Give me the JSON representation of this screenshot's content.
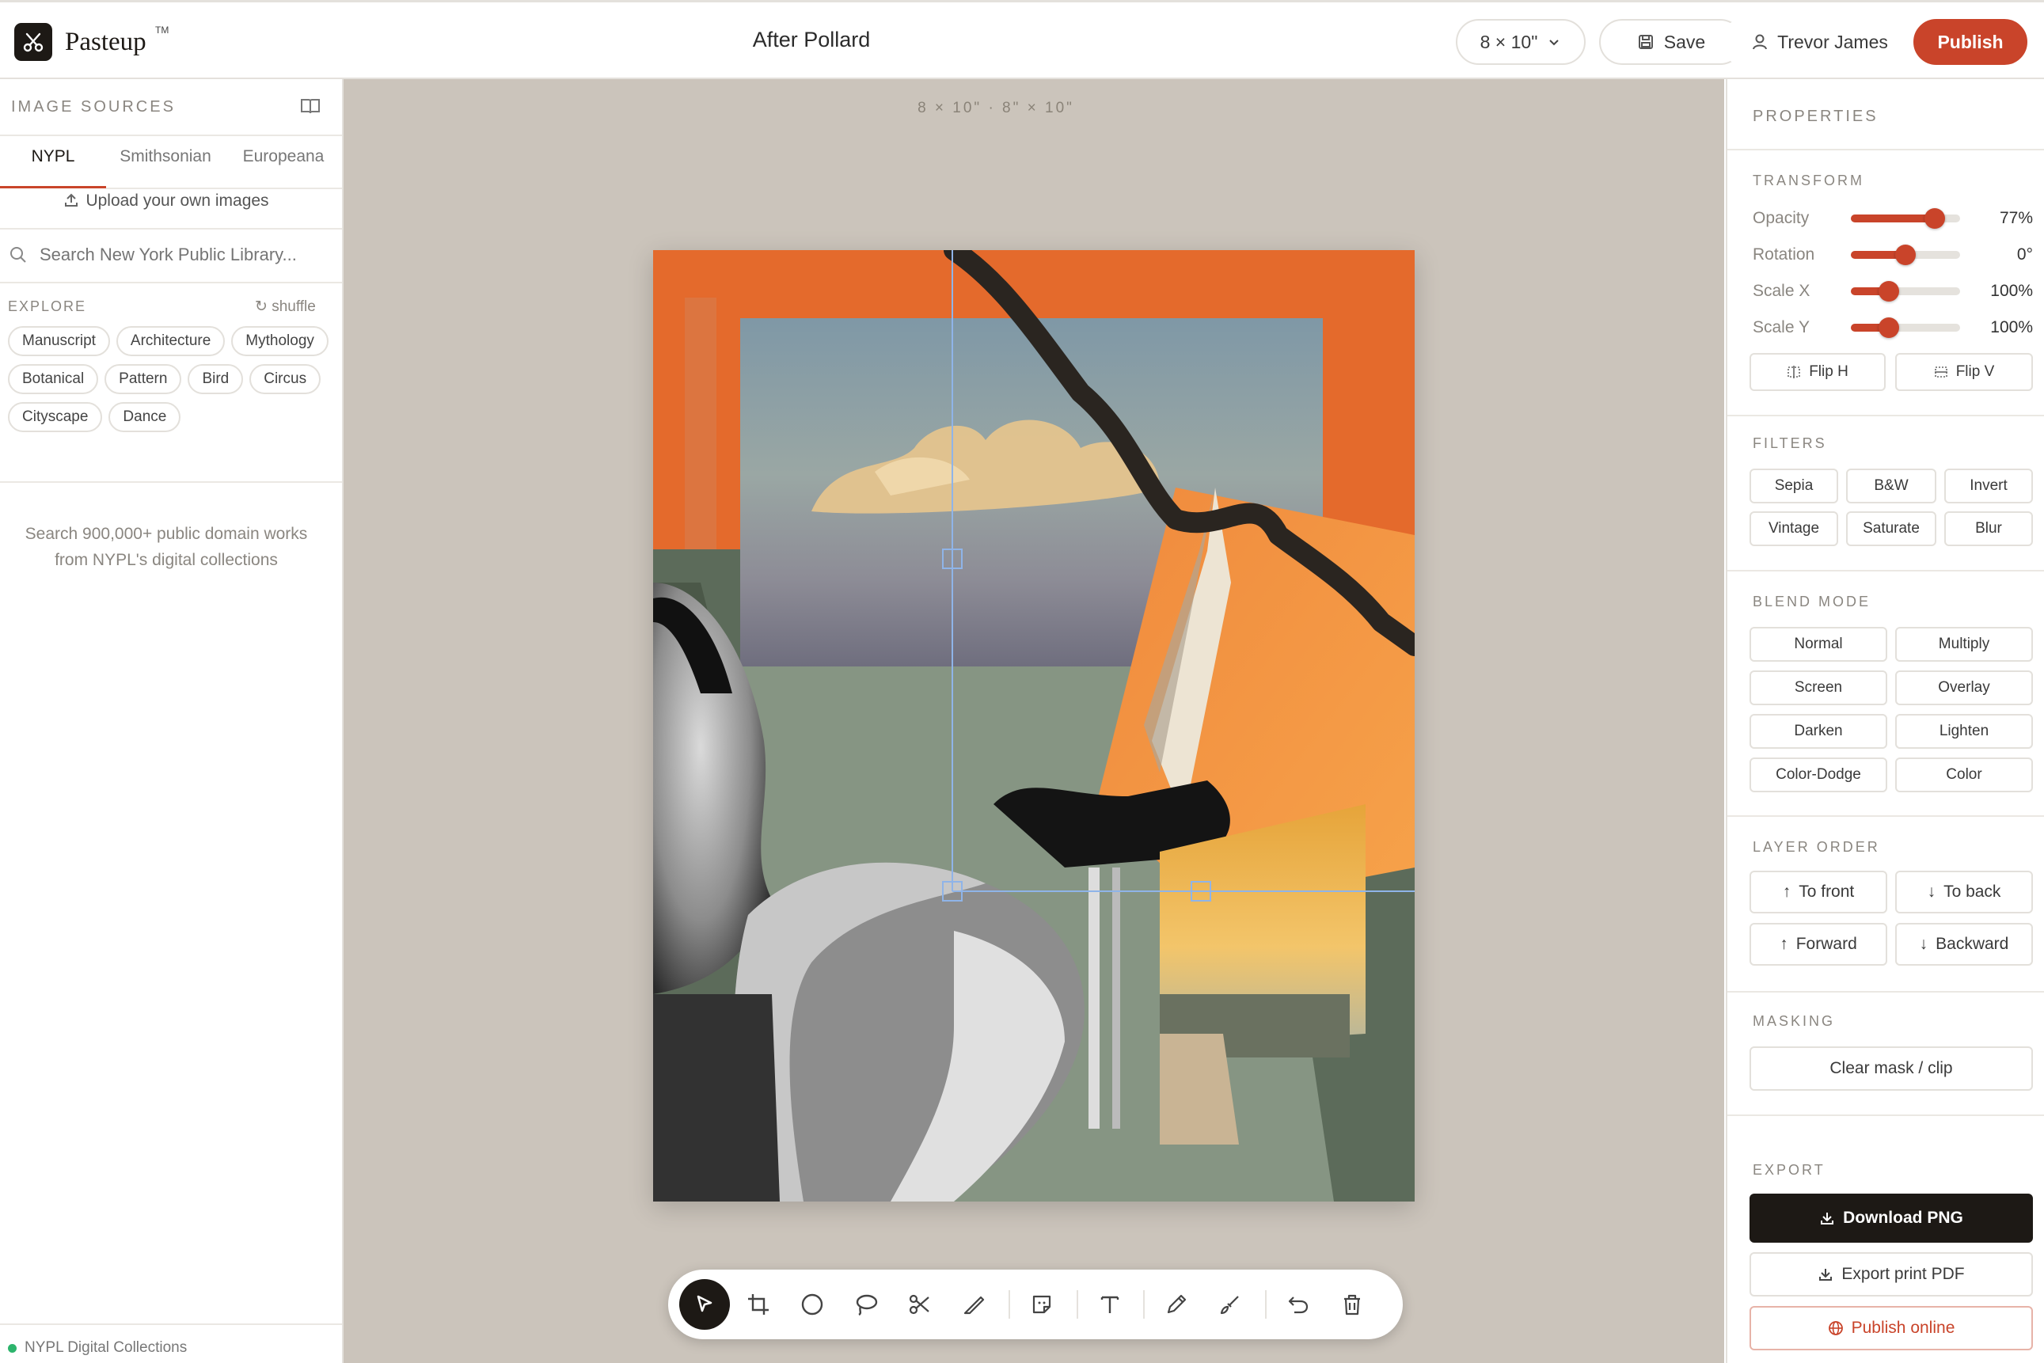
{
  "app": {
    "name": "Pasteup",
    "trademark": "TM"
  },
  "header": {
    "doc_title": "After Pollard",
    "size_select": "8 × 10\"",
    "save_label": "Save",
    "user_name": "Trevor James",
    "publish_label": "Publish"
  },
  "left": {
    "heading": "IMAGE SOURCES",
    "tabs": [
      {
        "label": "NYPL",
        "active": true
      },
      {
        "label": "Smithsonian"
      },
      {
        "label": "Europeana"
      }
    ],
    "upload_label": "Upload your own images",
    "search_placeholder": "Search New York Public Library...",
    "explore_label": "EXPLORE",
    "shuffle_label": "shuffle",
    "chips": [
      "Manuscript",
      "Architecture",
      "Mythology",
      "Botanical",
      "Pattern",
      "Bird",
      "Circus",
      "Cityscape",
      "Dance"
    ],
    "hint_line1": "Search 900,000+ public domain works",
    "hint_line2": "from NYPL's digital collections",
    "footer": "NYPL Digital Collections"
  },
  "canvas": {
    "label": "8 × 10\" · 8\" × 10\"",
    "tools": [
      "select-icon",
      "crop-icon",
      "ellipse-icon",
      "lasso-icon",
      "scissors-icon",
      "knife-icon",
      "sticker-icon",
      "text-icon",
      "pencil-icon",
      "brush-icon",
      "undo-icon",
      "trash-icon"
    ]
  },
  "properties": {
    "heading": "PROPERTIES",
    "transform": {
      "label": "TRANSFORM",
      "opacity": {
        "label": "Opacity",
        "value": "77%",
        "fraction": 0.77
      },
      "rotation": {
        "label": "Rotation",
        "value": "0°",
        "fraction": 0.5
      },
      "scale_x": {
        "label": "Scale X",
        "value": "100%",
        "fraction": 0.35
      },
      "scale_y": {
        "label": "Scale Y",
        "value": "100%",
        "fraction": 0.35
      },
      "flip_h": "Flip H",
      "flip_v": "Flip V"
    },
    "filters": {
      "label": "FILTERS",
      "items": [
        "Sepia",
        "B&W",
        "Invert",
        "Vintage",
        "Saturate",
        "Blur"
      ]
    },
    "blend": {
      "label": "BLEND MODE",
      "items": [
        "Normal",
        "Multiply",
        "Screen",
        "Overlay",
        "Darken",
        "Lighten",
        "Color-Dodge",
        "Color"
      ]
    },
    "layer_order": {
      "label": "LAYER ORDER",
      "to_front": "To front",
      "to_back": "To back",
      "forward": "Forward",
      "backward": "Backward"
    },
    "masking": {
      "label": "MASKING",
      "clear": "Clear mask / clip"
    },
    "export": {
      "label": "EXPORT",
      "download_png": "Download PNG",
      "export_pdf": "Export print PDF",
      "publish_online": "Publish online"
    }
  },
  "colors": {
    "accent": "#c9442a",
    "dark": "#1d1915",
    "canvas_bg": "#cbc4bb",
    "selection": "#8fb4e8"
  }
}
